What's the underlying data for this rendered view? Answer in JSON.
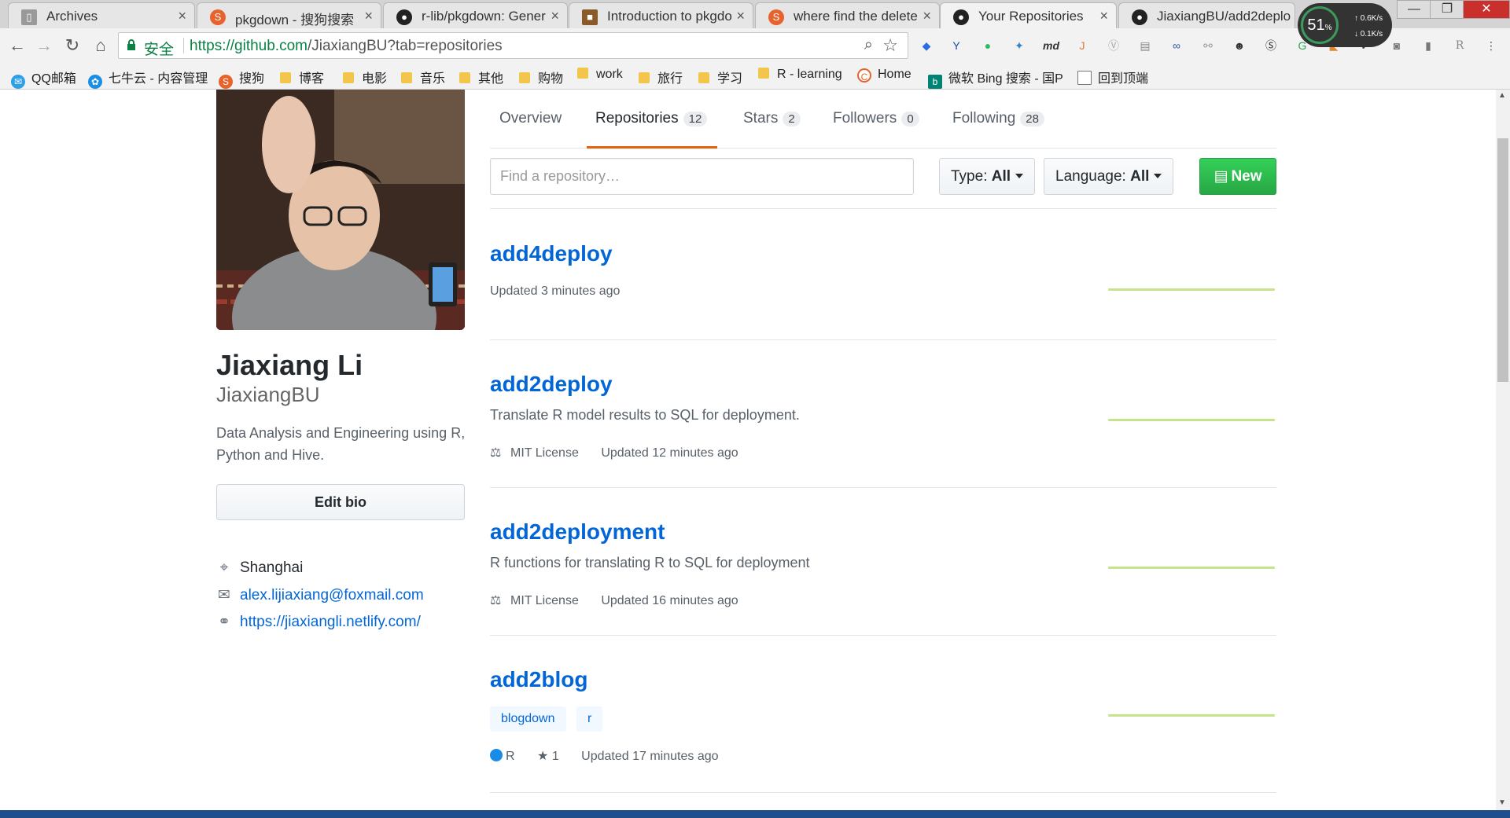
{
  "browser": {
    "tabs": [
      {
        "title": "Archives",
        "icon": "page-icon"
      },
      {
        "title": "pkgdown - 搜狗搜索",
        "icon": "sogou-icon"
      },
      {
        "title": "r-lib/pkgdown: Gener",
        "icon": "github-icon"
      },
      {
        "title": "Introduction to pkgdo",
        "icon": "package-icon"
      },
      {
        "title": "where find the delete",
        "icon": "sogou-icon"
      },
      {
        "title": "Your Repositories",
        "icon": "github-icon"
      },
      {
        "title": "JiaxiangBU/add2deplo",
        "icon": "github-icon"
      }
    ],
    "speed": {
      "percent": "51",
      "percent_unit": "%",
      "up": "0.6K/s",
      "down": "0.1K/s"
    },
    "secure_label": "安全",
    "url_base": "https://github.com",
    "url_rest": "/JiaxiangBU?tab=repositories",
    "bookmarks": [
      {
        "label": "QQ邮箱",
        "type": "icon"
      },
      {
        "label": "七牛云 - 内容管理",
        "type": "icon"
      },
      {
        "label": "搜狗",
        "type": "icon"
      },
      {
        "label": "博客",
        "type": "folder"
      },
      {
        "label": "电影",
        "type": "folder"
      },
      {
        "label": "音乐",
        "type": "folder"
      },
      {
        "label": "其他",
        "type": "folder"
      },
      {
        "label": "购物",
        "type": "folder"
      },
      {
        "label": "work",
        "type": "folder"
      },
      {
        "label": "旅行",
        "type": "folder"
      },
      {
        "label": "学习",
        "type": "folder"
      },
      {
        "label": "R - learning",
        "type": "folder"
      },
      {
        "label": "Home",
        "type": "icon"
      },
      {
        "label": "微软 Bing 搜索 - 国P",
        "type": "icon"
      },
      {
        "label": "回到顶端",
        "type": "page"
      }
    ]
  },
  "profile": {
    "name": "Jiaxiang Li",
    "login": "JiaxiangBU",
    "bio": "Data Analysis and Engineering using R, Python and Hive.",
    "edit_bio_label": "Edit bio",
    "location": "Shanghai",
    "email": "alex.lijiaxiang@foxmail.com",
    "website": "https://jiaxiangli.netlify.com/"
  },
  "nav": {
    "tabs": [
      {
        "label": "Overview",
        "count": null
      },
      {
        "label": "Repositories",
        "count": "12"
      },
      {
        "label": "Stars",
        "count": "2"
      },
      {
        "label": "Followers",
        "count": "0"
      },
      {
        "label": "Following",
        "count": "28"
      }
    ]
  },
  "filters": {
    "search_placeholder": "Find a repository…",
    "type_label": "Type:",
    "type_value": "All",
    "language_label": "Language:",
    "language_value": "All",
    "new_label": "New"
  },
  "repos": [
    {
      "name": "add4deploy",
      "description": "",
      "license": "",
      "updated": "Updated 3 minutes ago"
    },
    {
      "name": "add2deploy",
      "description": "Translate R model results to SQL for deployment.",
      "license": "MIT License",
      "updated": "Updated 12 minutes ago"
    },
    {
      "name": "add2deployment",
      "description": "R functions for translating R to SQL for deployment",
      "license": "MIT License",
      "updated": "Updated 16 minutes ago"
    },
    {
      "name": "add2blog",
      "topics": [
        "blogdown",
        "r"
      ],
      "language": "R",
      "stars": "1",
      "updated": "Updated 17 minutes ago"
    }
  ],
  "colors": {
    "accent": "#0366d6",
    "selected_tab": "#e36209",
    "new_button": "#28a745",
    "lang_r": "#198ce7",
    "sparkline": "#c6e48b"
  }
}
